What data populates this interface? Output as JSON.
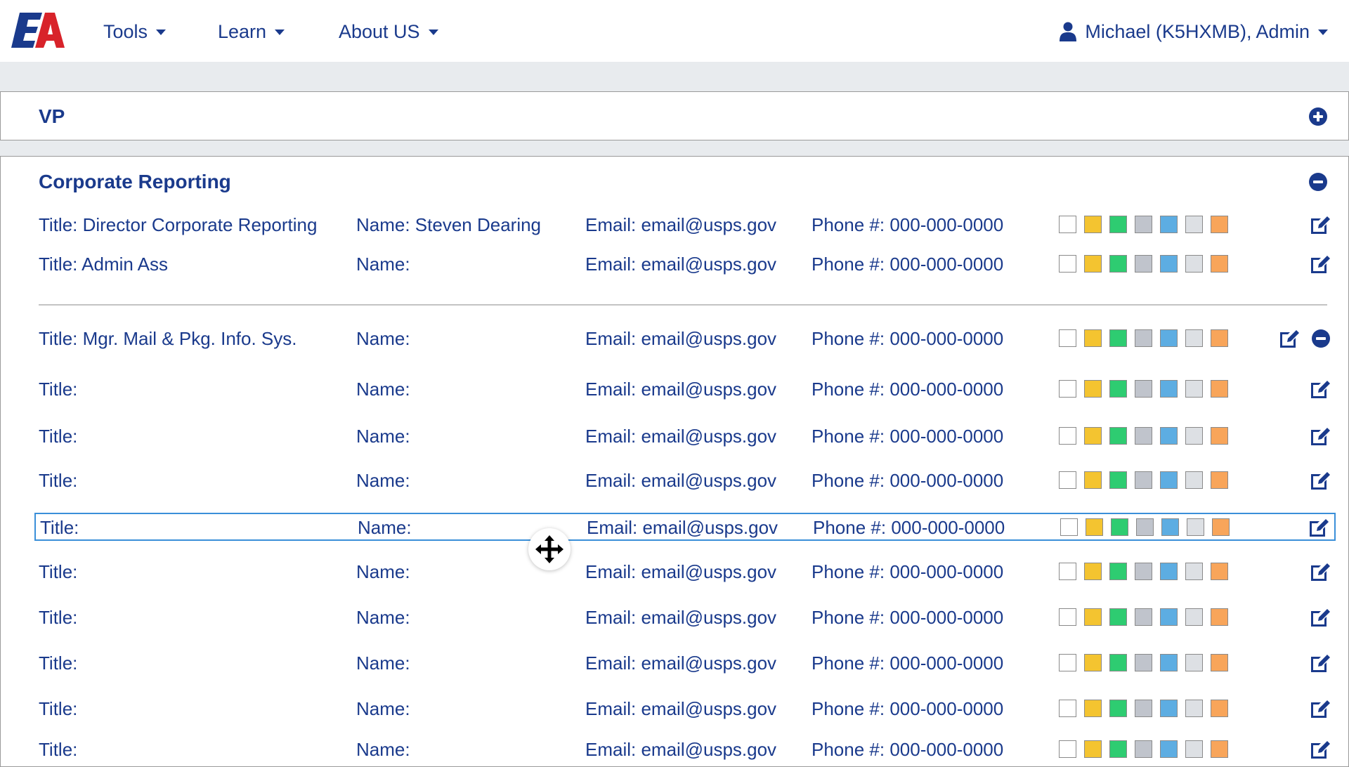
{
  "nav": {
    "logo_text": "EA",
    "items": [
      {
        "label": "Tools"
      },
      {
        "label": "Learn"
      },
      {
        "label": "About US"
      }
    ],
    "user_label": "Michael (K5HXMB), Admin"
  },
  "panels": {
    "vp": {
      "title": "VP"
    },
    "corporate": {
      "title": "Corporate Reporting"
    }
  },
  "swatch_colors": [
    "#ffffff",
    "#f4c430",
    "#2ecc71",
    "#c0c4cc",
    "#5dade2",
    "#dde0e4",
    "#f8a55a"
  ],
  "rows": [
    {
      "title": "Title: Director Corporate Reporting",
      "name": "Name: Steven Dearing",
      "email": "Email: email@usps.gov",
      "phone": "Phone #: 000-000-0000"
    },
    {
      "title": "Title: Admin Ass",
      "name": "Name:",
      "email": "Email: email@usps.gov",
      "phone": "Phone #: 000-000-0000"
    },
    {
      "title": "Title: Mgr. Mail & Pkg. Info. Sys.",
      "name": "Name:",
      "email": "Email: email@usps.gov",
      "phone": "Phone #: 000-000-0000"
    },
    {
      "title": "Title:",
      "name": "Name:",
      "email": "Email: email@usps.gov",
      "phone": "Phone #: 000-000-0000"
    },
    {
      "title": "Title:",
      "name": "Name:",
      "email": "Email: email@usps.gov",
      "phone": "Phone #: 000-000-0000"
    },
    {
      "title": "Title:",
      "name": "Name:",
      "email": "Email: email@usps.gov",
      "phone": "Phone #: 000-000-0000"
    },
    {
      "title": "Title:",
      "name": "Name:",
      "email": "Email: email@usps.gov",
      "phone": "Phone #: 000-000-0000"
    },
    {
      "title": "Title:",
      "name": "Name:",
      "email": "Email: email@usps.gov",
      "phone": "Phone #: 000-000-0000"
    },
    {
      "title": "Title:",
      "name": "Name:",
      "email": "Email: email@usps.gov",
      "phone": "Phone #: 000-000-0000"
    },
    {
      "title": "Title:",
      "name": "Name:",
      "email": "Email: email@usps.gov",
      "phone": "Phone #: 000-000-0000"
    },
    {
      "title": "Title:",
      "name": "Name:",
      "email": "Email: email@usps.gov",
      "phone": "Phone #: 000-000-0000"
    },
    {
      "title": "Title:",
      "name": "Name:",
      "email": "Email: email@usps.gov",
      "phone": "Phone #: 000-000-0000"
    }
  ]
}
